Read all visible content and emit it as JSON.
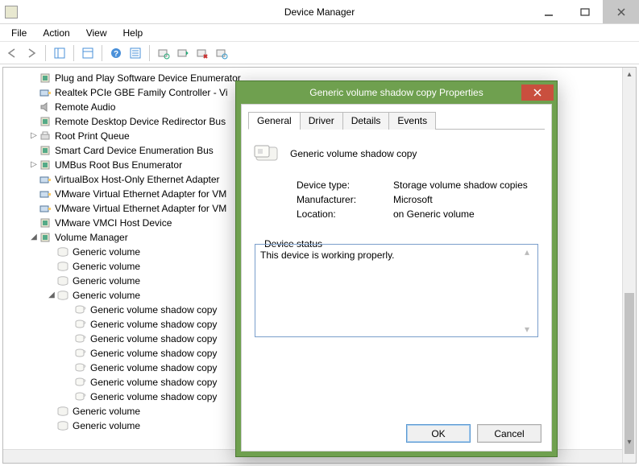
{
  "window": {
    "title": "Device Manager"
  },
  "menu": {
    "file": "File",
    "action": "Action",
    "view": "View",
    "help": "Help"
  },
  "toolbar": {
    "back": "back",
    "forward": "forward",
    "up": "up",
    "show_hide_tree": "show-hide-tree",
    "help": "help",
    "properties": "properties",
    "update": "update-driver",
    "scan": "scan-hardware",
    "uninstall": "uninstall",
    "disable": "disable"
  },
  "tree": {
    "items": [
      {
        "icon": "chip",
        "label": "Plug and Play Software Device Enumerator",
        "indent": 1
      },
      {
        "icon": "nic",
        "label": "Realtek PCIe GBE Family Controller - Vi",
        "indent": 1
      },
      {
        "icon": "audio",
        "label": "Remote Audio",
        "indent": 1
      },
      {
        "icon": "chip",
        "label": "Remote Desktop Device Redirector Bus",
        "indent": 1
      },
      {
        "icon": "printer",
        "label": "Root Print Queue",
        "indent": 1,
        "twisty": "▷"
      },
      {
        "icon": "chip",
        "label": "Smart Card Device Enumeration Bus",
        "indent": 1
      },
      {
        "icon": "chip",
        "label": "UMBus Root Bus Enumerator",
        "indent": 1,
        "twisty": "▷"
      },
      {
        "icon": "nic",
        "label": "VirtualBox Host-Only Ethernet Adapter",
        "indent": 1
      },
      {
        "icon": "nic",
        "label": "VMware Virtual Ethernet Adapter for VM",
        "indent": 1
      },
      {
        "icon": "nic",
        "label": "VMware Virtual Ethernet Adapter for VM",
        "indent": 1
      },
      {
        "icon": "chip",
        "label": "VMware VMCI Host Device",
        "indent": 1
      },
      {
        "icon": "chip",
        "label": "Volume Manager",
        "indent": 1,
        "twisty": "◢"
      },
      {
        "icon": "vol",
        "label": "Generic volume",
        "indent": 2
      },
      {
        "icon": "vol",
        "label": "Generic volume",
        "indent": 2
      },
      {
        "icon": "vol",
        "label": "Generic volume",
        "indent": 2
      },
      {
        "icon": "vol",
        "label": "Generic volume",
        "indent": 2,
        "twisty": "◢"
      },
      {
        "icon": "vsc",
        "label": "Generic volume shadow copy",
        "indent": 3
      },
      {
        "icon": "vsc",
        "label": "Generic volume shadow copy",
        "indent": 3
      },
      {
        "icon": "vsc",
        "label": "Generic volume shadow copy",
        "indent": 3
      },
      {
        "icon": "vsc",
        "label": "Generic volume shadow copy",
        "indent": 3
      },
      {
        "icon": "vsc",
        "label": "Generic volume shadow copy",
        "indent": 3
      },
      {
        "icon": "vsc",
        "label": "Generic volume shadow copy",
        "indent": 3
      },
      {
        "icon": "vsc",
        "label": "Generic volume shadow copy",
        "indent": 3
      },
      {
        "icon": "vol",
        "label": "Generic volume",
        "indent": 2
      },
      {
        "icon": "vol",
        "label": "Generic volume",
        "indent": 2
      }
    ]
  },
  "dialog": {
    "title": "Generic volume shadow copy Properties",
    "tabs": {
      "general": "General",
      "driver": "Driver",
      "details": "Details",
      "events": "Events"
    },
    "device_name": "Generic volume shadow copy",
    "labels": {
      "type": "Device type:",
      "mfr": "Manufacturer:",
      "loc": "Location:",
      "status": "Device status"
    },
    "values": {
      "type": "Storage volume shadow copies",
      "mfr": "Microsoft",
      "loc": "on Generic volume"
    },
    "status_text": "This device is working properly.",
    "buttons": {
      "ok": "OK",
      "cancel": "Cancel"
    }
  }
}
